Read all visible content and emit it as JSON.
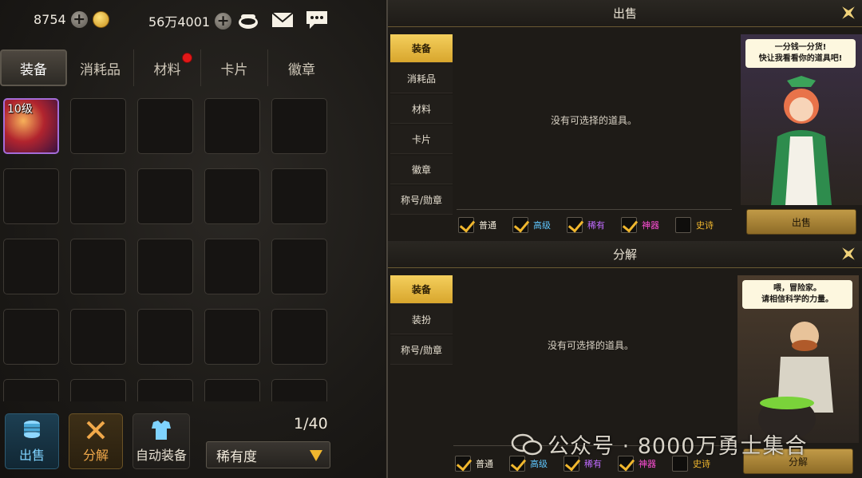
{
  "currency": {
    "points": "8754",
    "gold": "56万4001"
  },
  "inventory": {
    "tabs": [
      {
        "label": "装备",
        "active": true
      },
      {
        "label": "消耗品",
        "active": false
      },
      {
        "label": "材料",
        "active": false,
        "badge": true
      },
      {
        "label": "卡片",
        "active": false
      },
      {
        "label": "徽章",
        "active": false
      }
    ],
    "item_level": "10级",
    "count": "1/40",
    "sort_select": "稀有度",
    "actions": {
      "sell": "出售",
      "disassemble": "分解",
      "auto_equip": "自动装备"
    }
  },
  "sell_panel": {
    "title": "出售",
    "side_tabs": [
      "装备",
      "消耗品",
      "材料",
      "卡片",
      "徽章",
      "称号/勋章"
    ],
    "empty_text": "没有可选择的道具。",
    "npc_line1": "一分钱一分货!",
    "npc_line2": "快让我看看你的道具吧!",
    "button": "出售",
    "filters": [
      {
        "label": "普通",
        "color": "#f0e9d8",
        "checked": true
      },
      {
        "label": "高级",
        "color": "#5fc7ff",
        "checked": true
      },
      {
        "label": "稀有",
        "color": "#c06bff",
        "checked": true
      },
      {
        "label": "神器",
        "color": "#ff4fd6",
        "checked": true
      },
      {
        "label": "史诗",
        "color": "#f0b72e",
        "checked": false
      }
    ]
  },
  "disassemble_panel": {
    "title": "分解",
    "side_tabs": [
      "装备",
      "装扮",
      "称号/勋章"
    ],
    "empty_text": "没有可选择的道具。",
    "npc_line1": "喂，冒险家。",
    "npc_line2": "请相信科学的力量。",
    "button": "分解",
    "filters": [
      {
        "label": "普通",
        "color": "#f0e9d8",
        "checked": true
      },
      {
        "label": "高级",
        "color": "#5fc7ff",
        "checked": true
      },
      {
        "label": "稀有",
        "color": "#c06bff",
        "checked": true
      },
      {
        "label": "神器",
        "color": "#ff4fd6",
        "checked": true
      },
      {
        "label": "史诗",
        "color": "#f0b72e",
        "checked": false
      }
    ]
  },
  "watermark": "公众号 · 8000万勇士集合"
}
